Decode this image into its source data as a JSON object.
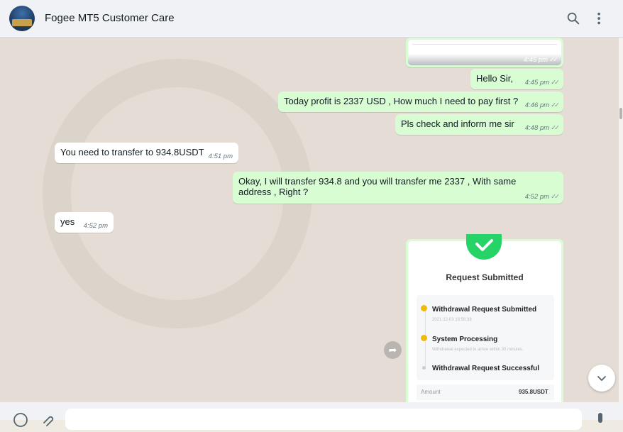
{
  "header": {
    "title": "Fogee MT5 Customer Care",
    "icons": [
      "search-icon",
      "menu-icon"
    ]
  },
  "messages": [
    {
      "id": "m1",
      "direction": "out",
      "type": "image-tail",
      "time": "4:45 pm",
      "ticks": "✓✓"
    },
    {
      "id": "m2",
      "direction": "out",
      "text": "Hello Sir,",
      "time": "4:45 pm",
      "ticks": "✓✓"
    },
    {
      "id": "m3",
      "direction": "out",
      "text": "Today profit is 2337 USD , How much I need to pay first ?",
      "time": "4:46 pm",
      "ticks": "✓✓"
    },
    {
      "id": "m4",
      "direction": "out",
      "text": "Pls check and inform me sir",
      "time": "4:48 pm",
      "ticks": "✓✓"
    },
    {
      "id": "m5",
      "direction": "in",
      "text": "You need to transfer to 934.8USDT",
      "time": "4:51 pm"
    },
    {
      "id": "m6",
      "direction": "out",
      "text": "Okay, I will transfer 934.8 and you will transfer me 2337 , With same address , Right ?",
      "time": "4:52 pm",
      "ticks": "✓✓"
    },
    {
      "id": "m7",
      "direction": "in",
      "text": "yes",
      "time": "4:52 pm"
    }
  ],
  "receipt": {
    "title": "Request Submitted",
    "steps": [
      {
        "label": "Withdrawal Request Submitted",
        "sub": "2021-12-03 16:56:38"
      },
      {
        "label": "System Processing",
        "sub": "Withdrawal expected to arrive within 30 minutes."
      },
      {
        "label": "Withdrawal Request Successful",
        "sub": ""
      }
    ],
    "amount_label": "Amount",
    "amount_value": "935.8USDT"
  },
  "colors": {
    "outgoing_bubble": "#d9fdd3",
    "incoming_bubble": "#ffffff",
    "chat_bg": "#e5ddd5",
    "check_green": "#25d366",
    "step_yellow": "#f0b90b"
  }
}
